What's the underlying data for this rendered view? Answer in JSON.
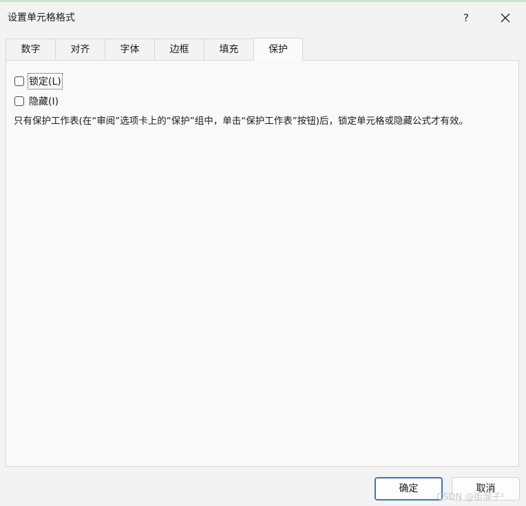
{
  "window": {
    "title": "设置单元格格式",
    "help_label": "?",
    "close_icon": "close-icon"
  },
  "tabs": [
    {
      "label": "数字",
      "active": false
    },
    {
      "label": "对齐",
      "active": false
    },
    {
      "label": "字体",
      "active": false
    },
    {
      "label": "边框",
      "active": false
    },
    {
      "label": "填充",
      "active": false
    },
    {
      "label": "保护",
      "active": true
    }
  ],
  "protection": {
    "locked": {
      "label": "锁定(L)",
      "checked": false
    },
    "hidden": {
      "label": "隐藏(I)",
      "checked": false
    },
    "description": "只有保护工作表(在“审阅”选项卡上的“保护”组中，单击“保护工作表”按钮)后，锁定单元格或隐藏公式才有效。"
  },
  "buttons": {
    "ok": "确定",
    "cancel": "取消"
  },
  "watermark": "CSDN @街溜子¹"
}
